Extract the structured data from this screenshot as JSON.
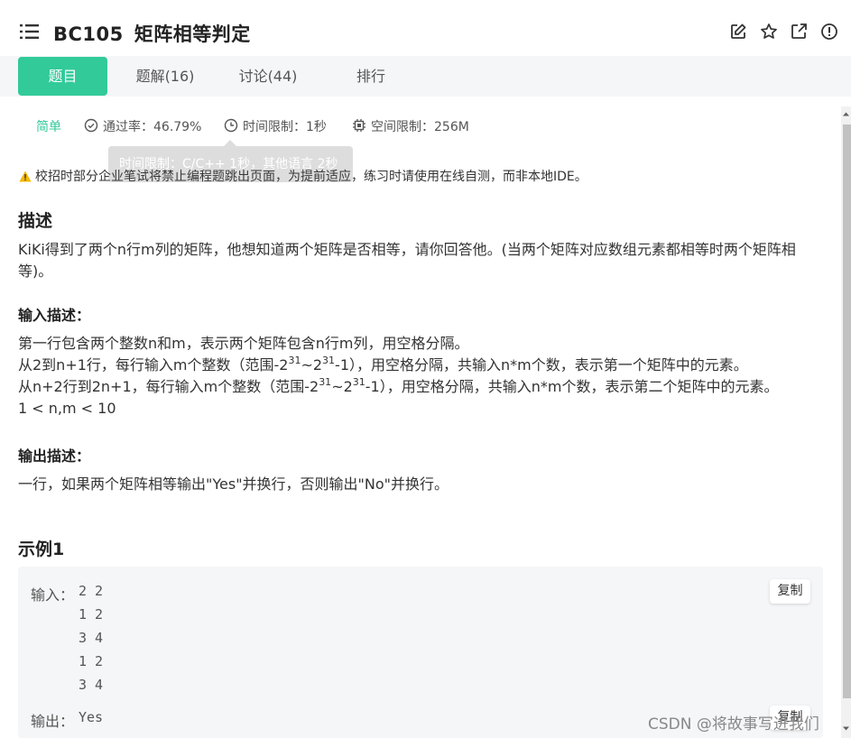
{
  "header": {
    "problem_id": "BC105",
    "problem_title": "矩阵相等判定",
    "icons": [
      "list-menu-icon",
      "edit-icon",
      "star-icon",
      "open-external-icon",
      "info-icon"
    ]
  },
  "tabs": [
    {
      "label": "题目",
      "active": true
    },
    {
      "label": "题解(16)",
      "active": false
    },
    {
      "label": "讨论(44)",
      "active": false
    },
    {
      "label": "排行",
      "active": false
    }
  ],
  "meta": {
    "difficulty": "简单",
    "pass_rate": "通过率：46.79%",
    "time_limit": "时间限制：1秒",
    "space_limit": "空间限制：256M"
  },
  "tooltip": "时间限制：C/C++ 1秒，其他语言 2秒",
  "warning": "校招时部分企业笔试将禁止编程题跳出页面，为提前适应，练习时请使用在线自测，而非本地IDE。",
  "description": {
    "heading": "描述",
    "text": "KiKi得到了两个n行m列的矩阵，他想知道两个矩阵是否相等，请你回答他。(当两个矩阵对应数组元素都相等时两个矩阵相等)。"
  },
  "input_desc": {
    "heading": "输入描述：",
    "line1": "第一行包含两个整数n和m，表示两个矩阵包含n行m列，用空格分隔。",
    "line2_a": "从2到n+1行，每行输入m个整数（范围-2",
    "line2_sup1": "31",
    "line2_b": "~2",
    "line2_sup2": "31",
    "line2_c": "-1），用空格分隔，共输入n*m个数，表示第一个矩阵中的元素。",
    "line3_a": "从n+2行到2n+1，每行输入m个整数（范围-2",
    "line3_sup1": "31",
    "line3_b": "~2",
    "line3_sup2": "31",
    "line3_c": "-1），用空格分隔，共输入n*m个数，表示第二个矩阵中的元素。",
    "line4": "1 < n,m < 10"
  },
  "output_desc": {
    "heading": "输出描述：",
    "text": "一行，如果两个矩阵相等输出\"Yes\"并换行，否则输出\"No\"并换行。"
  },
  "example": {
    "heading": "示例1",
    "input_label": "输入：",
    "input_lines": [
      "2 2",
      "1 2",
      "3 4",
      "1 2",
      "3 4"
    ],
    "output_label": "输出：",
    "output_value": "Yes",
    "copy_label": "复制"
  },
  "watermark": "CSDN @将故事写进我们"
}
